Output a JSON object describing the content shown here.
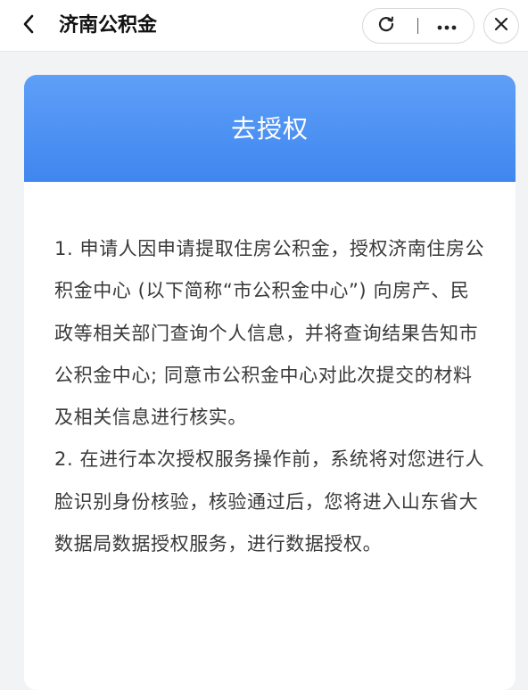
{
  "nav": {
    "title": "济南公积金"
  },
  "icons": {
    "back": "chevron-left-icon",
    "refresh": "refresh-icon",
    "more": "more-dots-icon",
    "close": "close-icon"
  },
  "card": {
    "title": "去授权",
    "paragraphs": [
      "1. 申请人因申请提取住房公积金，授权济南住房公积金中心 (以下简称“市公积金中心”) 向房产、民政等相关部门查询个人信息，并将查询结果告知市公积金中心; 同意市公积金中心对此次提交的材料及相关信息进行核实。",
      "2. 在进行本次授权服务操作前，系统将对您进行人脸识别身份核验，核验通过后，您将进入山东省大数据局数据授权服务，进行数据授权。"
    ]
  },
  "colors": {
    "header_gradient_top": "#5e9ff7",
    "header_gradient_bottom": "#3f86ef",
    "background": "#f2f3f5",
    "text": "#3a3a3a"
  }
}
